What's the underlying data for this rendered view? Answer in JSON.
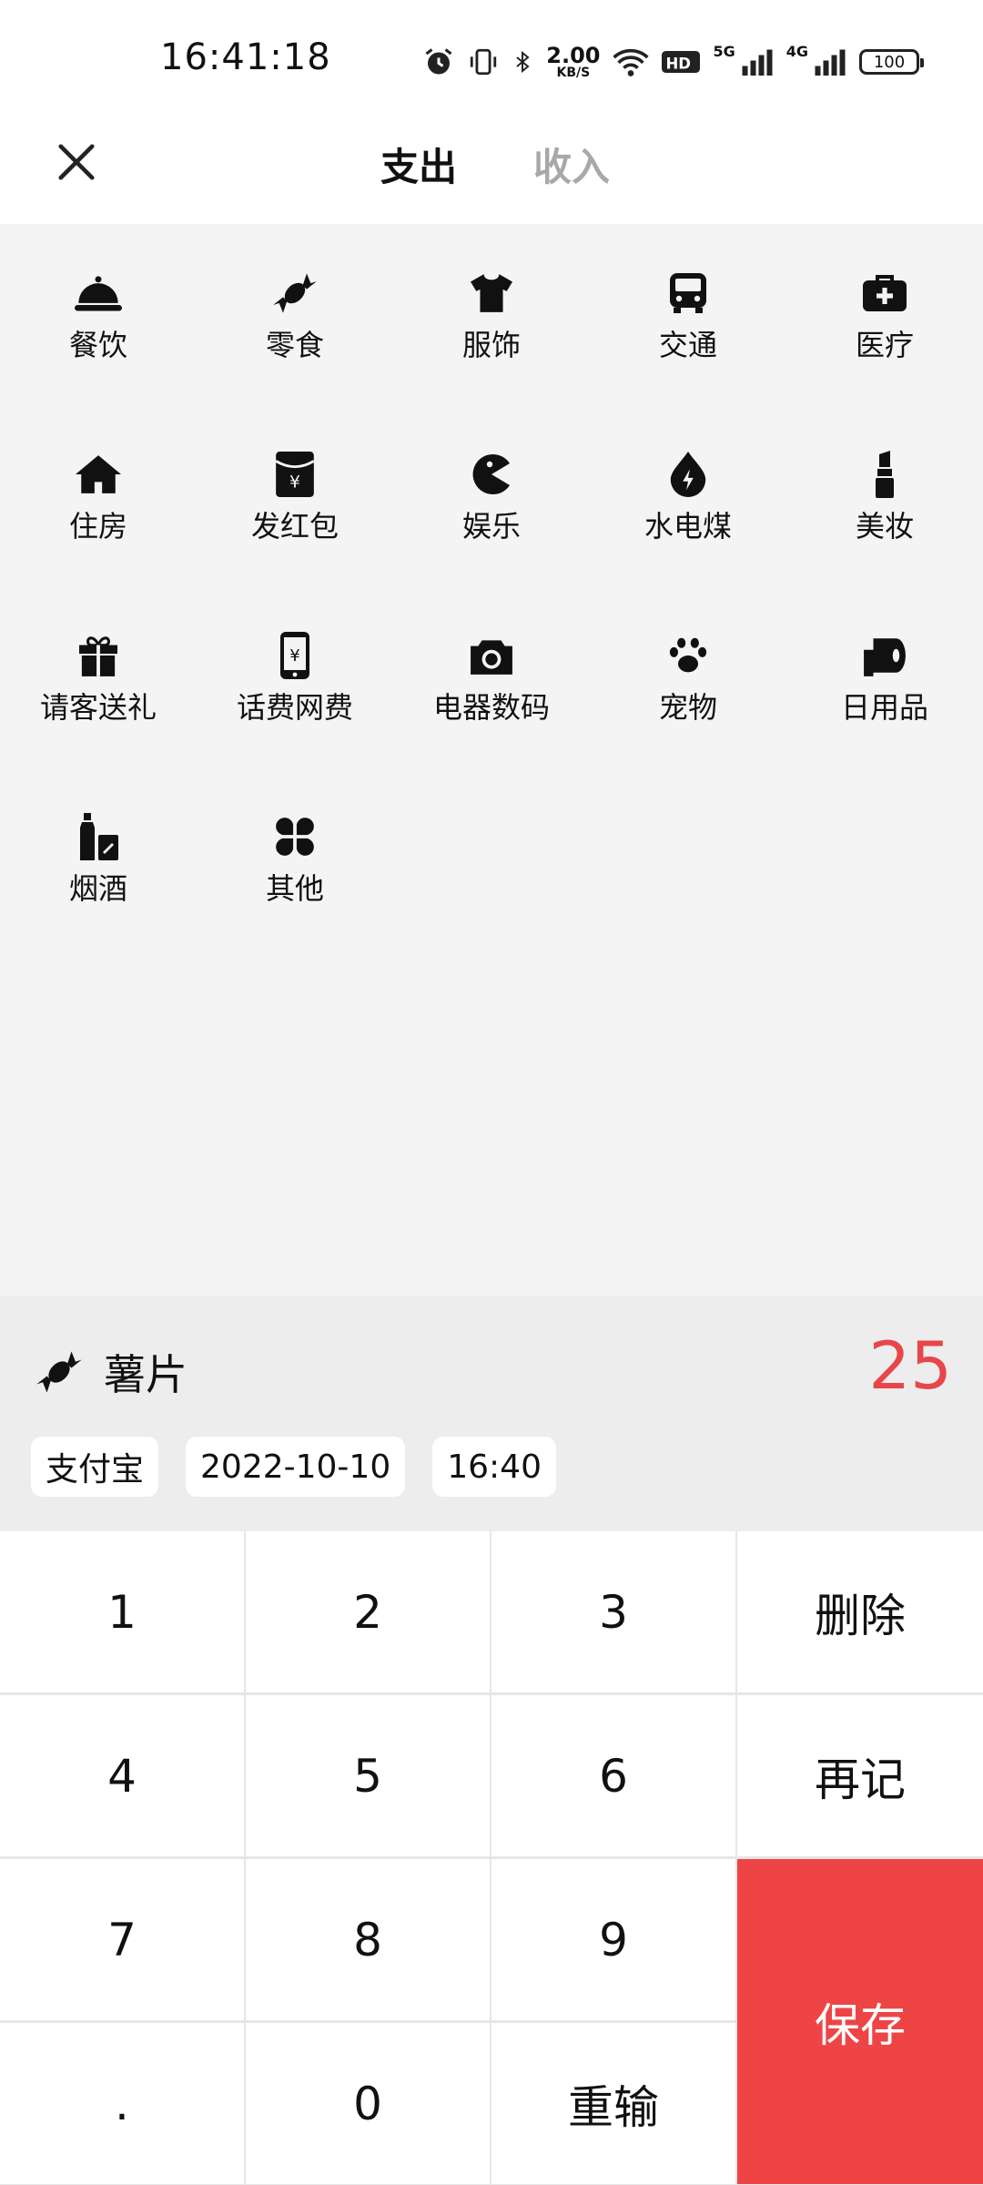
{
  "status_bar": {
    "time": "16:41:18",
    "speed_value": "2.00",
    "speed_unit": "KB/S",
    "net_5g": "5G",
    "net_4g": "4G",
    "battery": "100",
    "icons": [
      "alarm-icon",
      "vibrate-icon",
      "bluetooth-icon",
      "wifi-icon",
      "hd-icon",
      "signal-icon",
      "signal-icon",
      "battery-icon"
    ]
  },
  "header": {
    "close_icon": "close-icon",
    "tab_expense": "支出",
    "tab_income": "收入"
  },
  "categories": [
    {
      "label": "餐饮",
      "icon": "cloche-icon"
    },
    {
      "label": "零食",
      "icon": "candy-icon"
    },
    {
      "label": "服饰",
      "icon": "shirt-icon"
    },
    {
      "label": "交通",
      "icon": "bus-icon"
    },
    {
      "label": "医疗",
      "icon": "medkit-icon"
    },
    {
      "label": "住房",
      "icon": "house-icon"
    },
    {
      "label": "发红包",
      "icon": "red-envelope-icon"
    },
    {
      "label": "娱乐",
      "icon": "pacman-icon"
    },
    {
      "label": "水电煤",
      "icon": "utilities-drop-icon"
    },
    {
      "label": "美妆",
      "icon": "lipstick-icon"
    },
    {
      "label": "请客送礼",
      "icon": "gift-icon"
    },
    {
      "label": "话费网费",
      "icon": "phone-icon"
    },
    {
      "label": "电器数码",
      "icon": "camera-icon"
    },
    {
      "label": "宠物",
      "icon": "paw-icon"
    },
    {
      "label": "日用品",
      "icon": "toilet-roll-icon"
    },
    {
      "label": "烟酒",
      "icon": "bottles-icon"
    },
    {
      "label": "其他",
      "icon": "clover-icon"
    }
  ],
  "entry": {
    "category_icon": "candy-icon",
    "category_name": "薯片",
    "amount": "25",
    "payment": "支付宝",
    "date": "2022-10-10",
    "time": "16:40"
  },
  "keypad": {
    "k1": "1",
    "k2": "2",
    "k3": "3",
    "delete": "删除",
    "k4": "4",
    "k5": "5",
    "k6": "6",
    "again": "再记",
    "k7": "7",
    "k8": "8",
    "k9": "9",
    "save": "保存",
    "dot": ".",
    "k0": "0",
    "reenter": "重输"
  },
  "colors": {
    "accent_red": "#ef4446",
    "amount_red": "#e8464a",
    "panel_bg": "#f4f4f4",
    "entry_bg": "#ededed",
    "inactive_tab": "#a8a8a8"
  }
}
